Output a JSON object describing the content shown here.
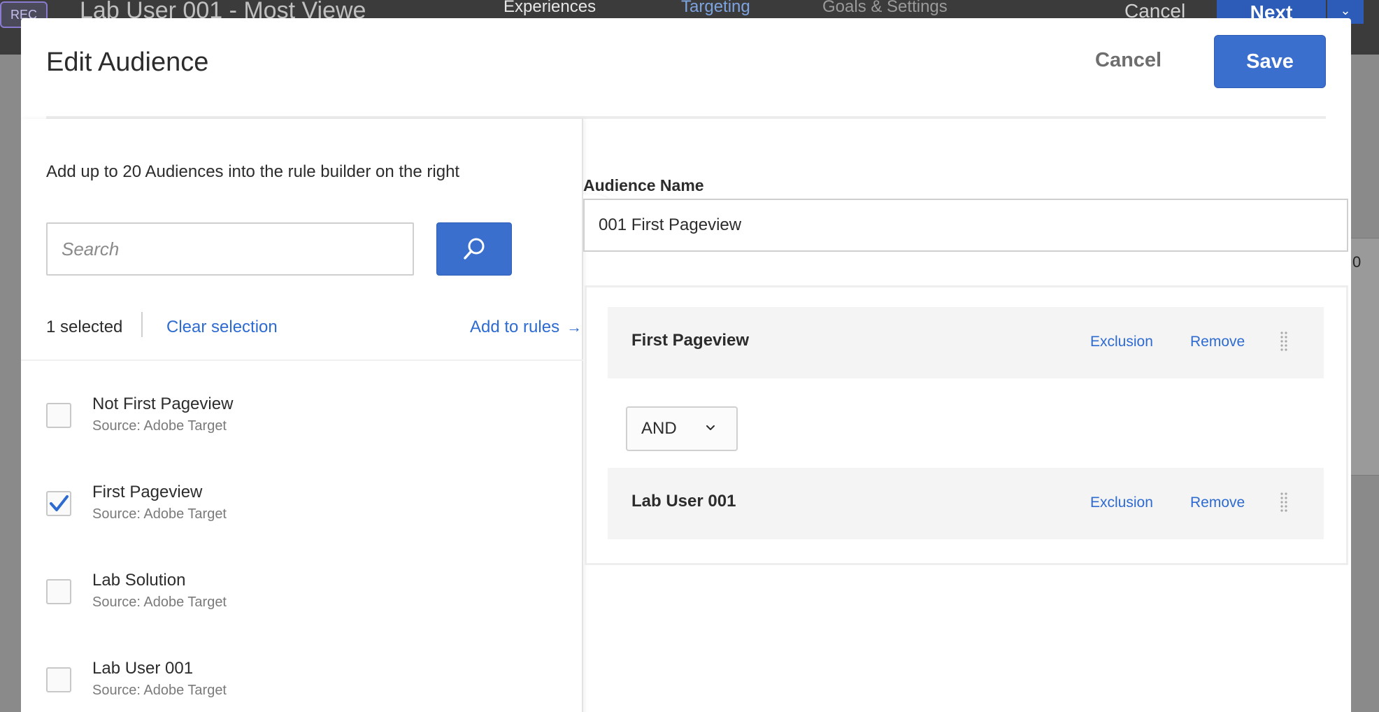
{
  "background": {
    "rec_badge": "REC",
    "activity_title": "Lab User 001 - Most Viewe",
    "tabs": [
      {
        "label": "Experiences"
      },
      {
        "label": "Targeting"
      },
      {
        "label": "Goals & Settings"
      }
    ],
    "cancel_label": "Cancel",
    "next_label": "Next",
    "right_edge_digit": "0"
  },
  "modal": {
    "title": "Edit Audience",
    "cancel_label": "Cancel",
    "save_label": "Save"
  },
  "left_panel": {
    "hint": "Add up to 20 Audiences into the rule builder on the right",
    "search": {
      "placeholder": "Search",
      "value": ""
    },
    "selected_count": "1 selected",
    "clear_selection": "Clear selection",
    "add_to_rules": "Add to rules",
    "audiences": [
      {
        "name": "Not First Pageview",
        "source": "Source: Adobe Target",
        "checked": false
      },
      {
        "name": "First Pageview",
        "source": "Source: Adobe Target",
        "checked": true
      },
      {
        "name": "Lab Solution",
        "source": "Source: Adobe Target",
        "checked": false
      },
      {
        "name": "Lab User 001",
        "source": "Source: Adobe Target",
        "checked": false
      }
    ]
  },
  "right_panel": {
    "name_label": "Audience Name",
    "name_value": "001 First Pageview",
    "rules": [
      {
        "name": "First Pageview",
        "exclusion": "Exclusion",
        "remove": "Remove"
      },
      {
        "name": "Lab User 001",
        "exclusion": "Exclusion",
        "remove": "Remove"
      }
    ],
    "operator": "AND"
  },
  "colors": {
    "accent": "#3b6fce",
    "link": "#2e6bd1",
    "rule_bg": "#f4f4f4"
  }
}
